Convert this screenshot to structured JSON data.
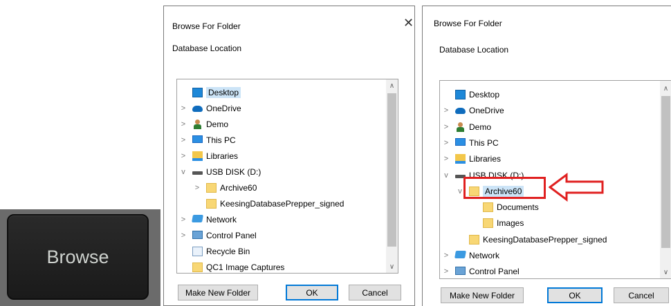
{
  "browse_button": {
    "label": "Browse"
  },
  "dialog_left": {
    "title": "Browse For Folder",
    "close": "✕",
    "subtitle": "Database Location",
    "tree": [
      {
        "label": "Desktop",
        "chevron": "",
        "icon": "desktop-icon",
        "selected": true
      },
      {
        "label": "OneDrive",
        "chevron": ">",
        "icon": "cloud-icon"
      },
      {
        "label": "Demo",
        "chevron": ">",
        "icon": "user-icon"
      },
      {
        "label": "This PC",
        "chevron": ">",
        "icon": "pc-icon"
      },
      {
        "label": "Libraries",
        "chevron": ">",
        "icon": "libraries-icon"
      },
      {
        "label": "USB DISK (D:)",
        "chevron": "v",
        "icon": "usb-drive-icon"
      },
      {
        "label": "Archive60",
        "chevron": ">",
        "icon": "folder-icon"
      },
      {
        "label": "KeesingDatabasePrepper_signed",
        "chevron": "",
        "icon": "folder-icon"
      },
      {
        "label": "Network",
        "chevron": ">",
        "icon": "network-icon"
      },
      {
        "label": "Control Panel",
        "chevron": ">",
        "icon": "control-panel-icon"
      },
      {
        "label": "Recycle Bin",
        "chevron": "",
        "icon": "recycle-bin-icon"
      },
      {
        "label": "QC1 Image Captures",
        "chevron": "",
        "icon": "folder-icon"
      }
    ],
    "buttons": {
      "new_folder": "Make New Folder",
      "ok": "OK",
      "cancel": "Cancel"
    }
  },
  "dialog_right": {
    "title": "Browse For Folder",
    "subtitle": "Database Location",
    "tree": [
      {
        "label": "Desktop",
        "chevron": "",
        "icon": "desktop-icon"
      },
      {
        "label": "OneDrive",
        "chevron": ">",
        "icon": "cloud-icon"
      },
      {
        "label": "Demo",
        "chevron": ">",
        "icon": "user-icon"
      },
      {
        "label": "This PC",
        "chevron": ">",
        "icon": "pc-icon"
      },
      {
        "label": "Libraries",
        "chevron": ">",
        "icon": "libraries-icon"
      },
      {
        "label": "USB DISK (D:)",
        "chevron": "v",
        "icon": "usb-drive-icon"
      },
      {
        "label": "Archive60",
        "chevron": "v",
        "icon": "folder-icon",
        "selected": true
      },
      {
        "label": "Documents",
        "chevron": "",
        "icon": "folder-icon"
      },
      {
        "label": "Images",
        "chevron": "",
        "icon": "folder-icon"
      },
      {
        "label": "KeesingDatabasePrepper_signed",
        "chevron": "",
        "icon": "folder-icon"
      },
      {
        "label": "Network",
        "chevron": ">",
        "icon": "network-icon"
      },
      {
        "label": "Control Panel",
        "chevron": ">",
        "icon": "control-panel-icon"
      }
    ],
    "buttons": {
      "new_folder": "Make New Folder",
      "ok": "OK",
      "cancel": "Cancel"
    }
  },
  "colors": {
    "highlight": "#e02020",
    "selection": "#cce4f7",
    "accent": "#0078d7"
  }
}
